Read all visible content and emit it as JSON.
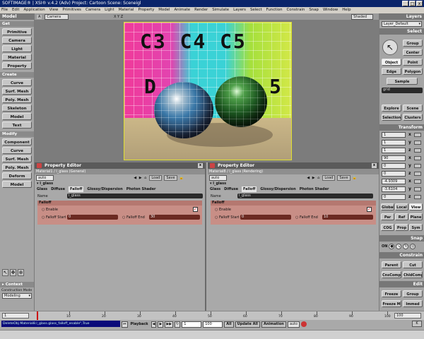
{
  "window": {
    "title": "SOFTIMAGE® | XSI® v.4.2 (Adv) Project: Cartoon   Scene: Sceneigl",
    "buttons": [
      "_",
      "□",
      "x"
    ]
  },
  "menu": [
    "File",
    "Edit",
    "Application",
    "View",
    "Primitives",
    "Camera",
    "Light",
    "Material",
    "Property",
    "Model",
    "Animate",
    "Render",
    "Simulate",
    "Layers",
    "Select",
    "Function",
    "Constrain",
    "Snap",
    "Window",
    "Help"
  ],
  "left": {
    "header": "Model",
    "get_header": "Get",
    "get": [
      "Primitive",
      "Camera",
      "Light",
      "Material",
      "Property"
    ],
    "create_header": "Create",
    "create": [
      "Curve",
      "Surf. Mesh",
      "Poly. Mesh",
      "Skeleton",
      "Model",
      "Text"
    ],
    "modify_header": "Modify",
    "modify": [
      "Component",
      "Curve",
      "Surf. Mesh",
      "Poly. Mesh",
      "Deform",
      "Model"
    ],
    "context_header": "Context",
    "construction_label": "Construction Mode",
    "construction_value": "Modeling"
  },
  "viewport": {
    "camera_label": "Camera",
    "shading_label": "Shaded",
    "axes": "X Y Z",
    "texture_text_row1": "C3 C4 C5",
    "texture_text_row2a": "D",
    "texture_text_row2b": "5",
    "colors": {
      "left": "#f03a9a",
      "mid": "#3ad2d6",
      "right": "#a5e03c"
    }
  },
  "editors": [
    {
      "title": "Property Editor",
      "subtitle": "Material1 / l_glass (General)",
      "dropdown": "auto",
      "load": "Load",
      "save": "Save",
      "node": "l_glass",
      "tabs": [
        "Glass",
        "Diffuse",
        "Falloff",
        "Glossy/Dispersion",
        "Photon Shader"
      ],
      "active_tab": "Falloff",
      "name_label": "Name",
      "name_value": "l_glass",
      "group": "Falloff",
      "enable_label": "Enable",
      "start_label": "Falloff Start",
      "start_value": "0",
      "end_label": "Falloff End",
      "end_value": "30"
    },
    {
      "title": "Property Editor",
      "subtitle": "Material8 / l_glass (Rendering)",
      "dropdown": "auto",
      "load": "Load",
      "save": "Save",
      "node": "l_glass",
      "tabs": [
        "Glass",
        "Diffuse",
        "Falloff",
        "Glossy/Dispersion",
        "Photon Shader"
      ],
      "active_tab": "Falloff",
      "name_label": "Name",
      "name_value": "l_glass",
      "group": "Falloff",
      "enable_label": "Enable",
      "start_label": "Falloff Start",
      "start_value": "0",
      "end_label": "Falloff End",
      "end_value": "10"
    }
  ],
  "right": {
    "layers_header": "Layers",
    "layer_value": "Layer_Default",
    "select_header": "Select",
    "select_buttons": [
      "Group",
      "Center",
      "Object",
      "Point",
      "Edge",
      "Polygon",
      "Sample"
    ],
    "search_value": "grid",
    "explore_buttons": [
      "Explore",
      "Scene",
      "Selection",
      "Clusters"
    ],
    "transform_header": "Transform",
    "transform_values": [
      "1",
      "1",
      "1",
      "90",
      "0",
      "0",
      "-4.9309",
      "-3.6104",
      "0"
    ],
    "axis_letters": [
      "x",
      "y",
      "z",
      "x",
      "y",
      "z",
      "x",
      "y",
      "z"
    ],
    "view_buttons": [
      "Global",
      "Local",
      "View",
      "Par",
      "Ref",
      "Plane",
      "COG",
      "Prop",
      "Sym"
    ],
    "snap_header": "Snap",
    "snap_on": "ON",
    "constrain_header": "Constrain",
    "constrain_buttons": [
      "Parent",
      "Cut",
      "CnsComp",
      "ChldComp"
    ],
    "edit_header": "Edit",
    "edit_buttons": [
      "Freeze",
      "Group",
      "Freeze M",
      "Immed"
    ]
  },
  "timeline": {
    "start": "1",
    "end": "100",
    "ticks": [
      "10",
      "20",
      "30",
      "40",
      "50",
      "60",
      "70",
      "80",
      "90",
      "100"
    ]
  },
  "bottom": {
    "command": "DeleteObj Material8.l_glass.glass_falloff_enable\",True",
    "playback": "Playback",
    "frame": "1",
    "end_frame": "100",
    "all": "All",
    "update": "Update All",
    "animation": "Animation",
    "auto": "auto",
    "key": "K"
  }
}
